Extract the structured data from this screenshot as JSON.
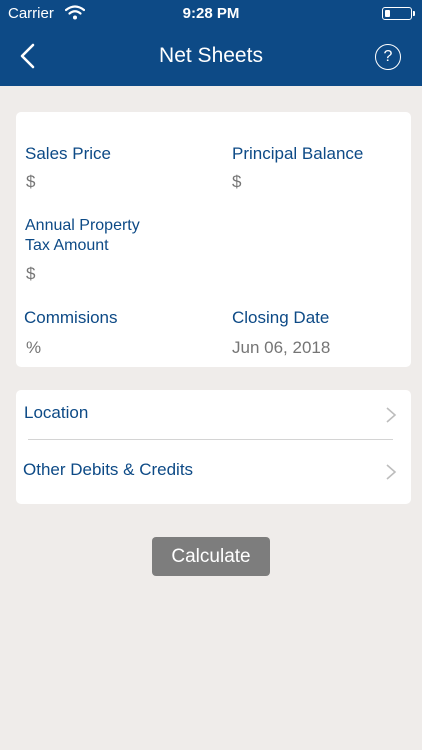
{
  "status_bar": {
    "carrier": "Carrier",
    "time": "9:28 PM"
  },
  "nav": {
    "title": "Net Sheets",
    "help_label": "?"
  },
  "form": {
    "sales_price": {
      "label": "Sales Price",
      "placeholder": "$"
    },
    "principal_balance": {
      "label": "Principal Balance",
      "placeholder": "$"
    },
    "annual_tax": {
      "label_line1": "Annual Property",
      "label_line2": "Tax Amount",
      "placeholder": "$"
    },
    "commissions": {
      "label": "Commisions",
      "placeholder": "%"
    },
    "closing_date": {
      "label": "Closing Date",
      "placeholder": "Jun 06, 2018"
    }
  },
  "menu": {
    "items": [
      {
        "label": "Location"
      },
      {
        "label": "Other Debits & Credits"
      }
    ]
  },
  "actions": {
    "calculate_label": "Calculate"
  },
  "colors": {
    "brand": "#0d4a86",
    "background": "#efecea",
    "placeholder": "#c7c7cc",
    "button": "#7d7d7d"
  }
}
